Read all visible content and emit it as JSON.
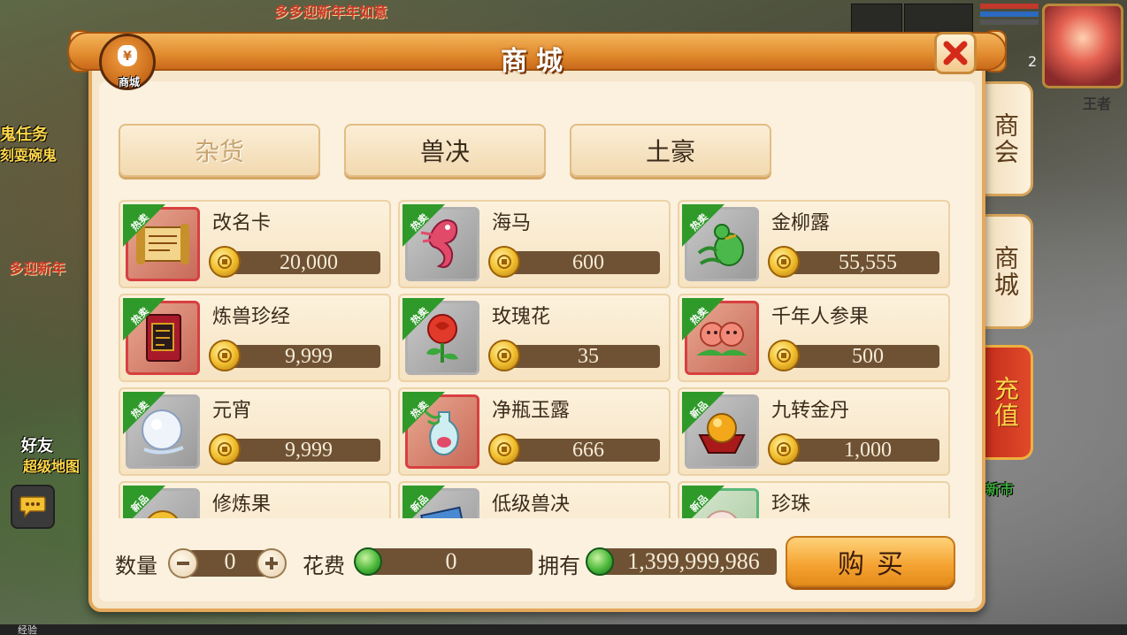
{
  "background": {
    "banner_top": "多多迎新年年如意",
    "quest_text": "鬼任务",
    "quest_sub": "刻耍碗鬼",
    "banner_left": "多迎新年",
    "friends": "好友",
    "super": "超级地图",
    "market": "新市",
    "player_name": "王者",
    "avatar_level": "2",
    "bottom_text": "经验"
  },
  "window": {
    "title": "商城",
    "icon_label": "商城",
    "icon_glyph": "¥"
  },
  "side_tabs": [
    {
      "label": "商会"
    },
    {
      "label": "商城"
    },
    {
      "label": "充值"
    }
  ],
  "category_tabs": [
    {
      "label": "杂货",
      "active": true
    },
    {
      "label": "兽决",
      "active": false
    },
    {
      "label": "土豪",
      "active": false
    }
  ],
  "items": [
    {
      "name": "改名卡",
      "price": "20,000",
      "badge": "热卖",
      "icon": "scroll-icon"
    },
    {
      "name": "海马",
      "price": "600",
      "badge": "热卖",
      "icon": "seahorse-icon"
    },
    {
      "name": "金柳露",
      "price": "55,555",
      "badge": "热卖",
      "icon": "gourd-icon"
    },
    {
      "name": "炼兽珍经",
      "price": "9,999",
      "badge": "热卖",
      "icon": "book-icon"
    },
    {
      "name": "玫瑰花",
      "price": "35",
      "badge": "热卖",
      "icon": "rose-icon"
    },
    {
      "name": "千年人参果",
      "price": "500",
      "badge": "热卖",
      "icon": "ginseng-fruit-icon"
    },
    {
      "name": "元宵",
      "price": "9,999",
      "badge": "热卖",
      "icon": "dumpling-icon"
    },
    {
      "name": "净瓶玉露",
      "price": "666",
      "badge": "热卖",
      "icon": "vase-icon"
    },
    {
      "name": "九转金丹",
      "price": "1,000",
      "badge": "新品",
      "icon": "elixir-icon"
    },
    {
      "name": "修炼果",
      "price": "",
      "badge": "新品",
      "icon": "fruit-icon"
    },
    {
      "name": "低级兽决",
      "price": "",
      "badge": "新品",
      "icon": "skillbook-icon"
    },
    {
      "name": "珍珠",
      "price": "",
      "badge": "新品",
      "icon": "pearl-icon"
    }
  ],
  "footer": {
    "quantity_label": "数量",
    "quantity": "0",
    "cost_label": "花费",
    "cost": "0",
    "own_label": "拥有",
    "owned": "1,399,999,986",
    "buy_label": "购买"
  },
  "colors": {
    "panel_border": "#e5a85a",
    "title_bar": "#e18a2e",
    "price_bar": "#6f5234",
    "hot_ribbon": "#2f9a2a",
    "recharge_tab": "#c22a1a",
    "close_x": "#d42a1a"
  }
}
